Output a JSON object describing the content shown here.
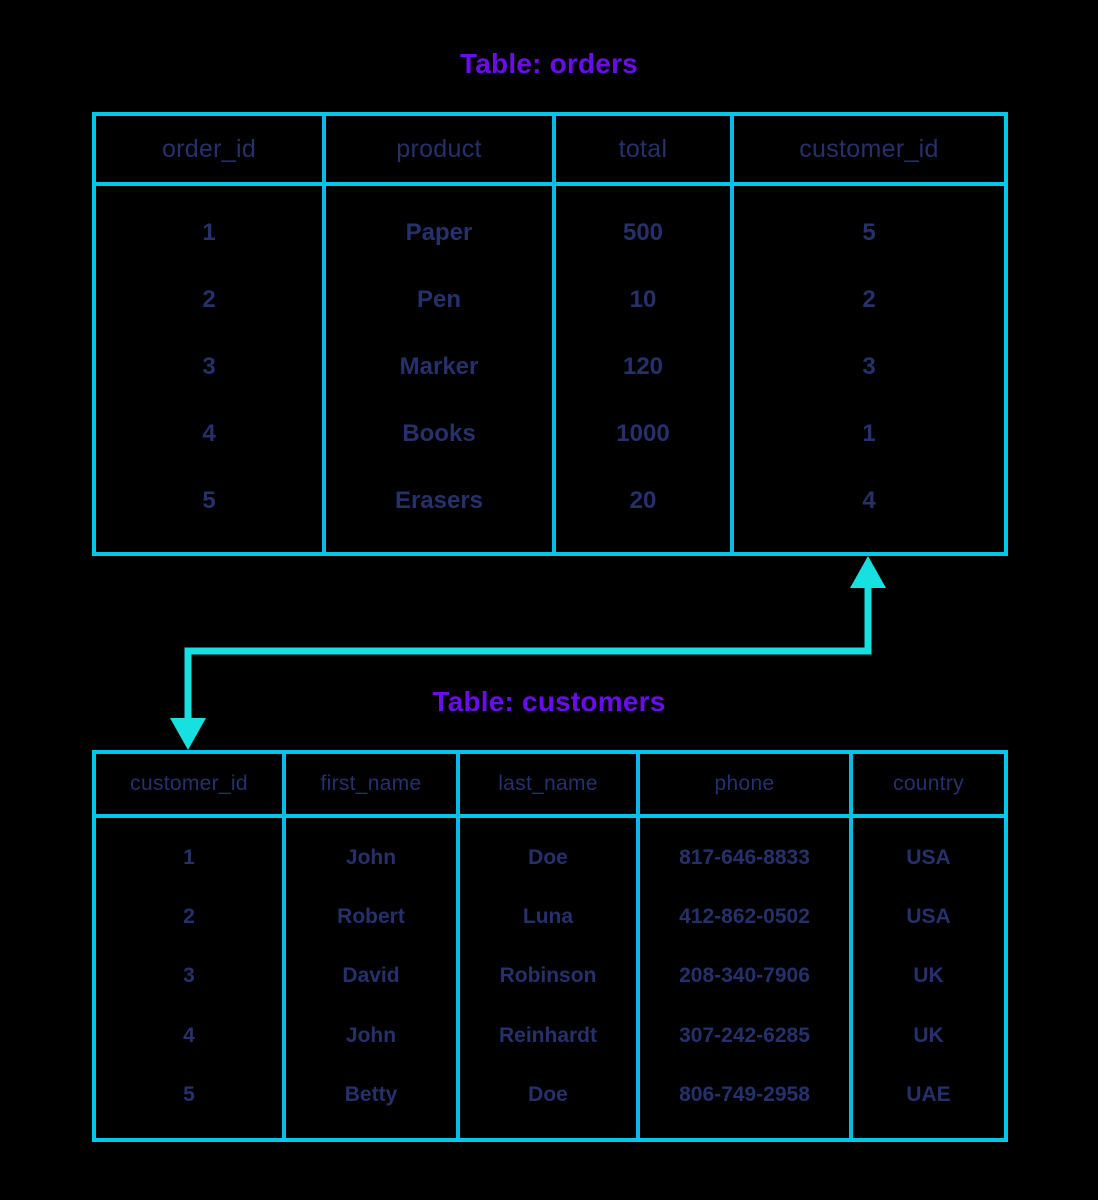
{
  "diagram": {
    "background_color": "#000000",
    "border_color": "#00c8e6",
    "text_color": "#26306b",
    "title_color": "#6a0deb",
    "connector_color": "#16e0e0"
  },
  "orders": {
    "title": "Table: orders",
    "columns": [
      "order_id",
      "product",
      "total",
      "customer_id"
    ],
    "rows": [
      [
        "1",
        "Paper",
        "500",
        "5"
      ],
      [
        "2",
        "Pen",
        "10",
        "2"
      ],
      [
        "3",
        "Marker",
        "120",
        "3"
      ],
      [
        "4",
        "Books",
        "1000",
        "1"
      ],
      [
        "5",
        "Erasers",
        "20",
        "4"
      ]
    ],
    "column_values": {
      "order_id": [
        "1",
        "2",
        "3",
        "4",
        "5"
      ],
      "product": [
        "Paper",
        "Pen",
        "Marker",
        "Books",
        "Erasers"
      ],
      "total": [
        "500",
        "10",
        "120",
        "1000",
        "20"
      ],
      "customer_id": [
        "5",
        "2",
        "3",
        "1",
        "4"
      ]
    }
  },
  "customers": {
    "title": "Table: customers",
    "columns": [
      "customer_id",
      "first_name",
      "last_name",
      "phone",
      "country"
    ],
    "rows": [
      [
        "1",
        "John",
        "Doe",
        "817-646-8833",
        "USA"
      ],
      [
        "2",
        "Robert",
        "Luna",
        "412-862-0502",
        "USA"
      ],
      [
        "3",
        "David",
        "Robinson",
        "208-340-7906",
        "UK"
      ],
      [
        "4",
        "John",
        "Reinhardt",
        "307-242-6285",
        "UK"
      ],
      [
        "5",
        "Betty",
        "Doe",
        "806-749-2958",
        "UAE"
      ]
    ],
    "column_values": {
      "customer_id": [
        "1",
        "2",
        "3",
        "4",
        "5"
      ],
      "first_name": [
        "John",
        "Robert",
        "David",
        "John",
        "Betty"
      ],
      "last_name": [
        "Doe",
        "Luna",
        "Robinson",
        "Reinhardt",
        "Doe"
      ],
      "phone": [
        "817-646-8833",
        "412-862-0502",
        "208-340-7906",
        "307-242-6285",
        "806-749-2958"
      ],
      "country": [
        "USA",
        "USA",
        "UK",
        "UK",
        "UAE"
      ]
    }
  },
  "relationship": {
    "from_table": "orders",
    "from_column": "customer_id",
    "to_table": "customers",
    "to_column": "customer_id",
    "arrow_style": "double-headed-elbow"
  }
}
